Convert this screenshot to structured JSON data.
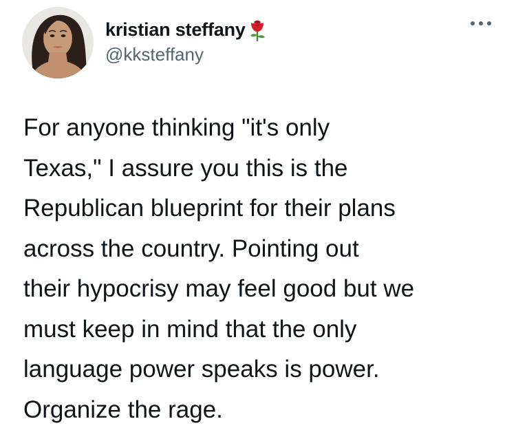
{
  "author": {
    "display_name": "kristian steffany",
    "handle": "@kksteffany",
    "name_emoji": "rose-icon",
    "avatar": "profile-photo"
  },
  "menu": {
    "icon": "more-options-icon"
  },
  "tweet": {
    "text": "For anyone thinking \"it's only\nTexas,\" I assure you this is the\nRepublican blueprint for their plans\nacross the country. Pointing out\ntheir hypocrisy may feel good but we\nmust keep in mind that the only\nlanguage power speaks is power.\nOrganize the rage."
  },
  "colors": {
    "text": "#0f1419",
    "secondary": "#536471",
    "rose": "#d21f2a",
    "stem": "#3f8a2e"
  }
}
